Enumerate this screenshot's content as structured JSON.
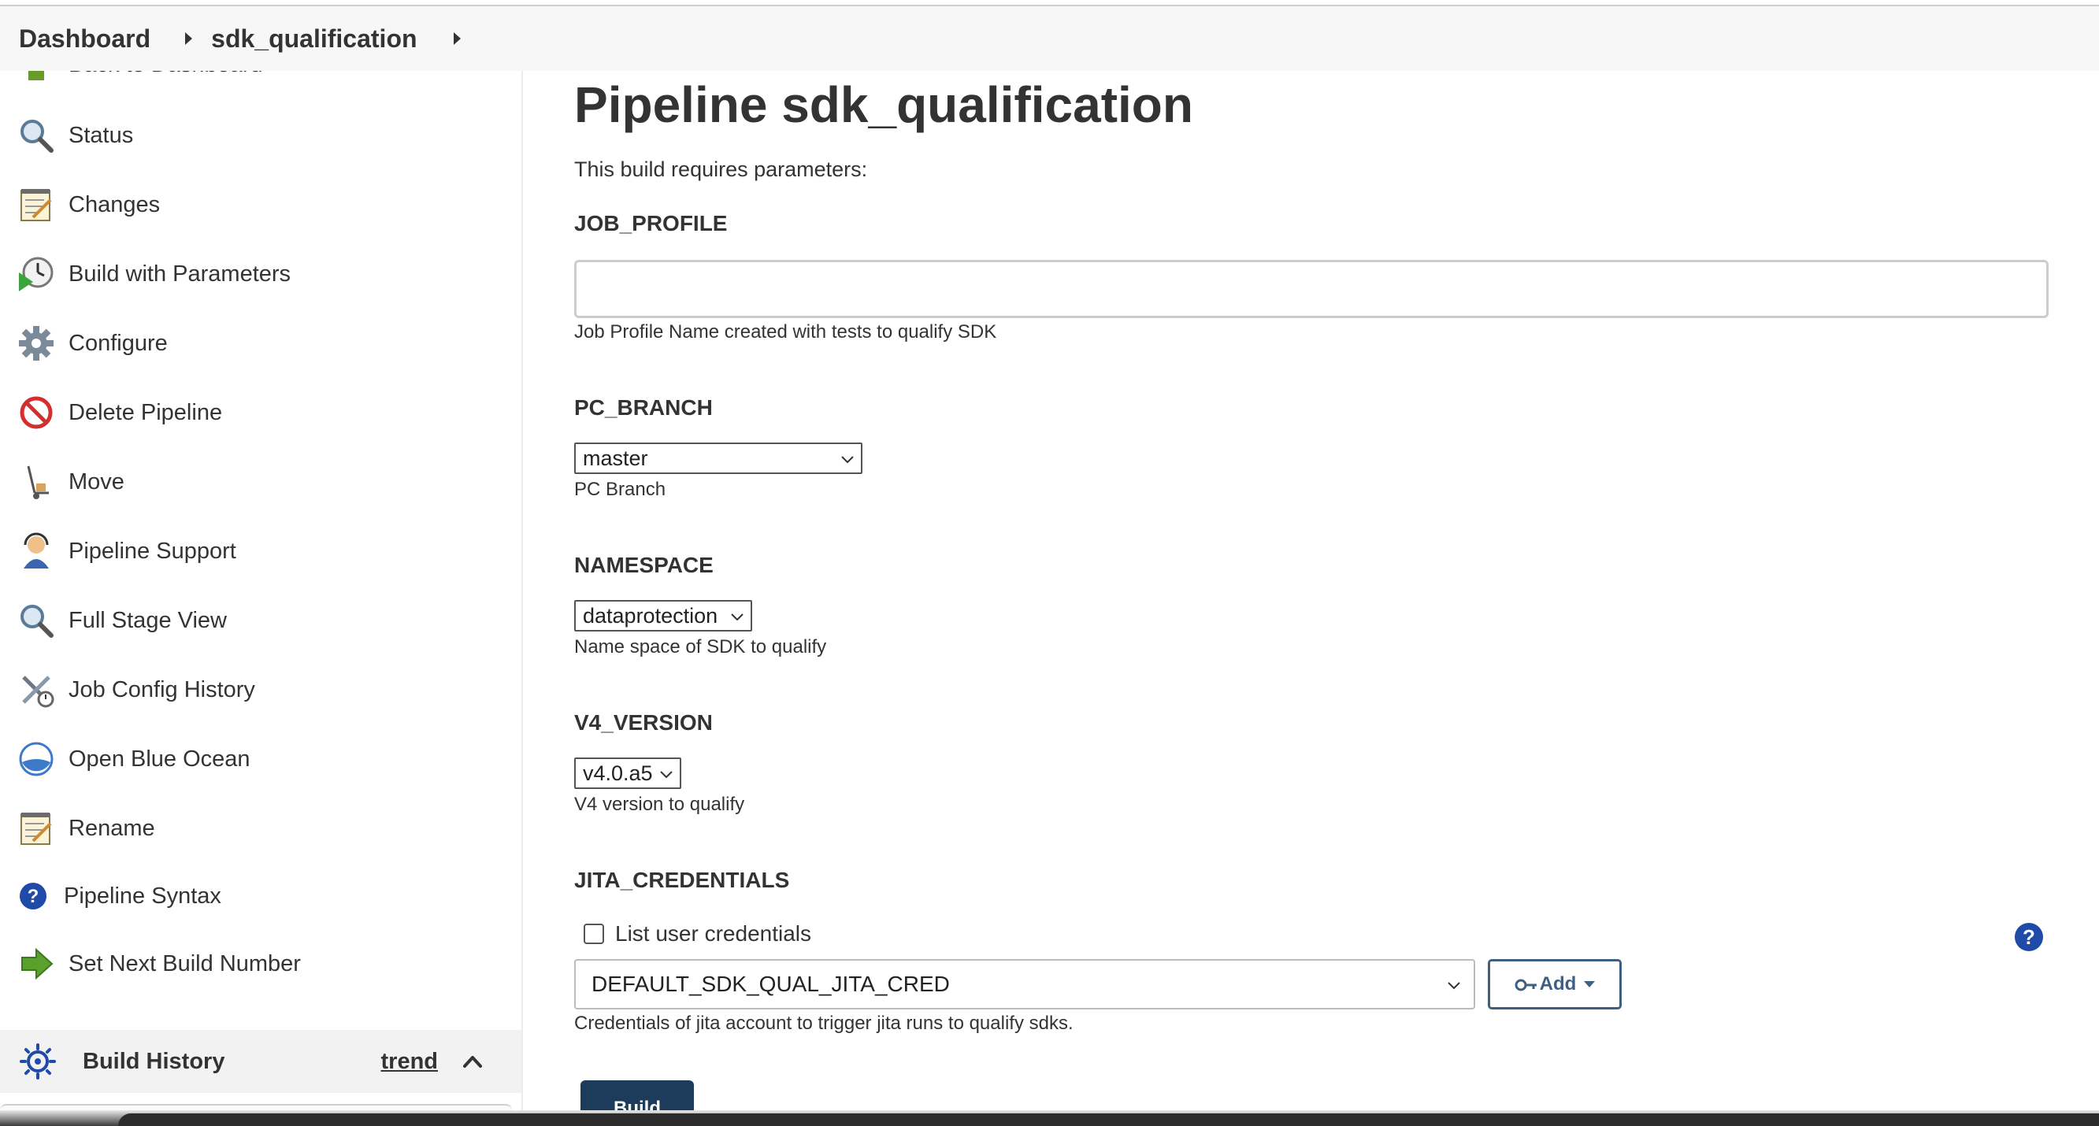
{
  "breadcrumb": {
    "items": [
      "Dashboard",
      "sdk_qualification"
    ]
  },
  "sidebar": {
    "partial_item": "Back to Dashboard",
    "items": [
      {
        "label": "Status",
        "icon": "magnifier-icon"
      },
      {
        "label": "Changes",
        "icon": "notepad-icon"
      },
      {
        "label": "Build with Parameters",
        "icon": "clock-play-icon"
      },
      {
        "label": "Configure",
        "icon": "gear-icon"
      },
      {
        "label": "Delete Pipeline",
        "icon": "no-entry-icon"
      },
      {
        "label": "Move",
        "icon": "hand-truck-icon"
      },
      {
        "label": "Pipeline Support",
        "icon": "support-person-icon"
      },
      {
        "label": "Full Stage View",
        "icon": "magnifier-icon"
      },
      {
        "label": "Job Config History",
        "icon": "tools-icon"
      },
      {
        "label": "Open Blue Ocean",
        "icon": "blue-ocean-icon"
      },
      {
        "label": "Rename",
        "icon": "notepad-icon"
      },
      {
        "label": "Pipeline Syntax",
        "icon": "help-circle-icon"
      },
      {
        "label": "Set Next Build Number",
        "icon": "green-arrow-icon"
      }
    ]
  },
  "build_history": {
    "title": "Build History",
    "trend_link": "trend"
  },
  "main": {
    "title": "Pipeline sdk_qualification",
    "intro": "This build requires parameters:",
    "params": {
      "job_profile": {
        "name": "JOB_PROFILE",
        "value": "",
        "description": "Job Profile Name created with tests to qualify SDK"
      },
      "pc_branch": {
        "name": "PC_BRANCH",
        "selected": "master",
        "description": "PC Branch"
      },
      "namespace": {
        "name": "NAMESPACE",
        "selected": "dataprotection",
        "description": "Name space of SDK to qualify"
      },
      "v4_version": {
        "name": "V4_VERSION",
        "selected": "v4.0.a5",
        "description": "V4 version to qualify"
      },
      "jita_credentials": {
        "name": "JITA_CREDENTIALS",
        "checkbox_label": "List user credentials",
        "checkbox_checked": false,
        "selected": "DEFAULT_SDK_QUAL_JITA_CRED",
        "add_label": "Add",
        "help": "?",
        "description": "Credentials of jita account to trigger jita runs to qualify sdks."
      }
    },
    "build_button": "Build"
  },
  "colors": {
    "primary_button": "#1d3b5a",
    "add_button_border": "#3f5f82",
    "help_icon": "#1f4aa8"
  }
}
